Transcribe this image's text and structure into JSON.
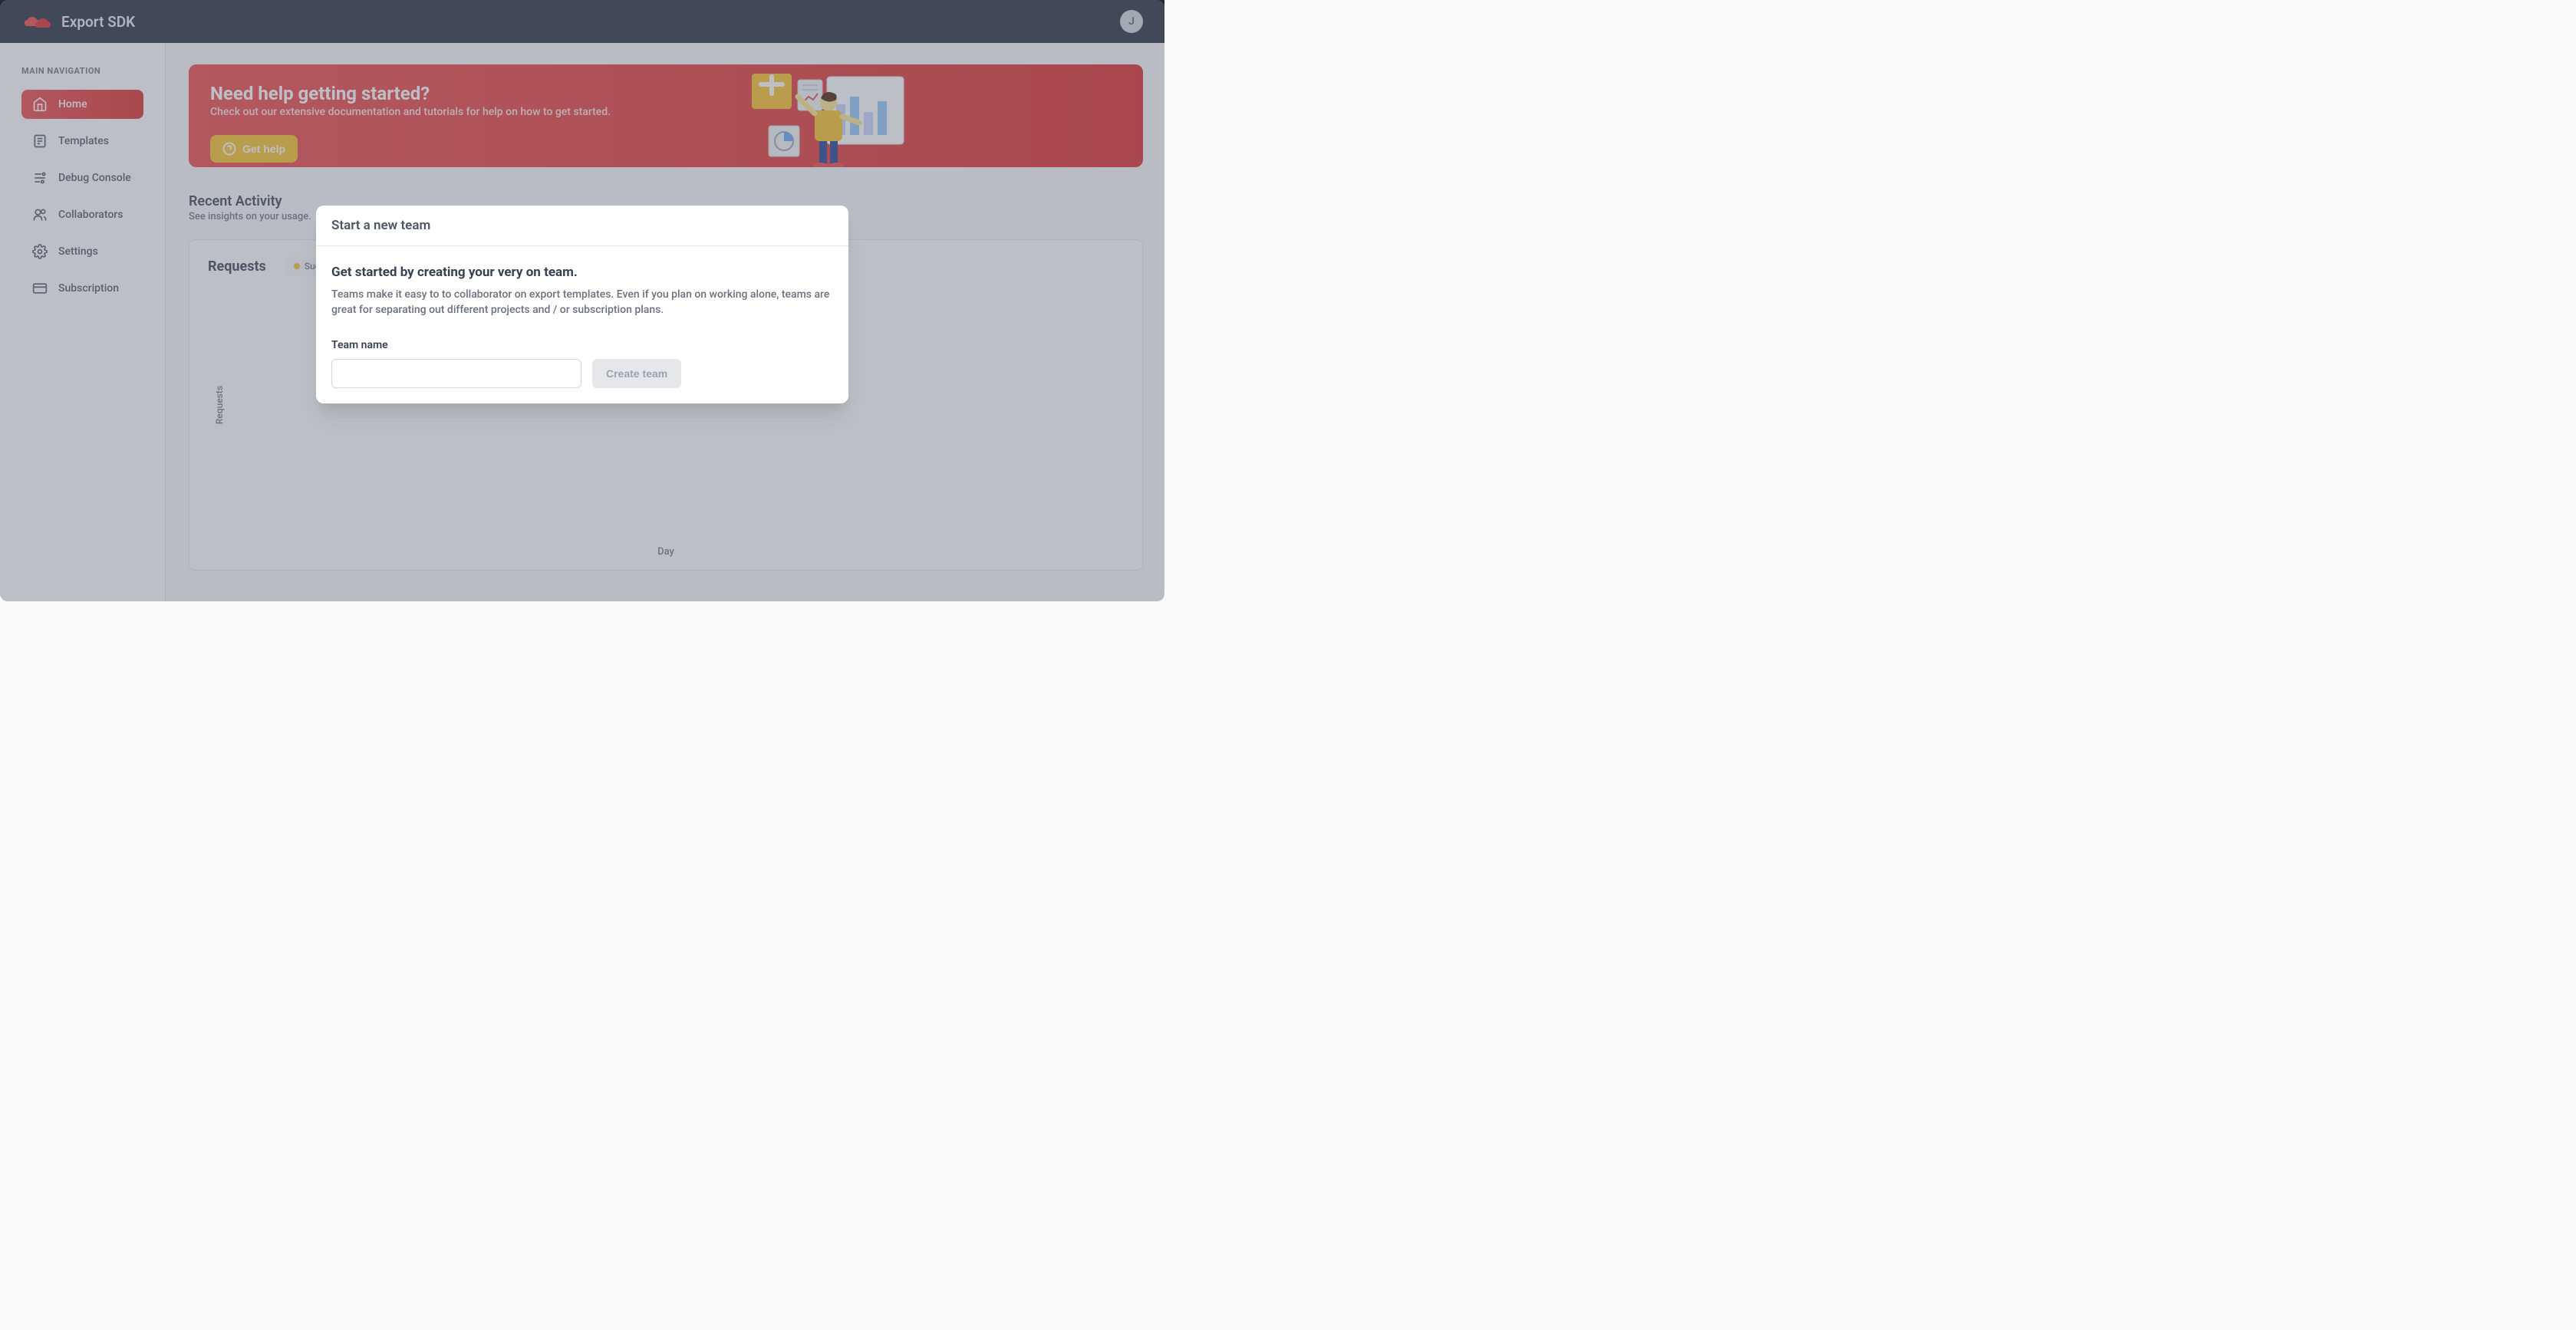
{
  "header": {
    "app_title": "Export SDK",
    "avatar_initial": "J"
  },
  "sidebar": {
    "heading": "MAIN NAVIGATION",
    "items": [
      {
        "label": "Home",
        "active": true
      },
      {
        "label": "Templates",
        "active": false
      },
      {
        "label": "Debug Console",
        "active": false
      },
      {
        "label": "Collaborators",
        "active": false
      },
      {
        "label": "Settings",
        "active": false
      },
      {
        "label": "Subscription",
        "active": false
      }
    ]
  },
  "banner": {
    "title": "Need help getting started?",
    "subtitle": "Check out our extensive documentation and tutorials for help on how to get started.",
    "button_label": "Get help"
  },
  "recent_activity": {
    "title": "Recent Activity",
    "subtitle": "See insights on your usage."
  },
  "chart": {
    "title": "Requests",
    "legend_success": "Succ",
    "xlabel": "Day",
    "ylabel": "Requests"
  },
  "chart_data": {
    "type": "bar",
    "title": "Requests",
    "xlabel": "Day",
    "ylabel": "Requests",
    "series": [
      {
        "name": "Success",
        "color": "#fbbf24",
        "values": []
      }
    ],
    "categories": []
  },
  "modal": {
    "header_title": "Start a new team",
    "body_title": "Get started by creating your very on team.",
    "body_desc": "Teams make it easy to to collaborator on export templates. Even if you plan on working alone, teams are great for separating out different projects and / or subscription plans.",
    "form_label": "Team name",
    "button_label": "Create team"
  },
  "colors": {
    "primary": "#ef4444",
    "accent": "#fbbf24",
    "header_bg": "#1f2937"
  }
}
